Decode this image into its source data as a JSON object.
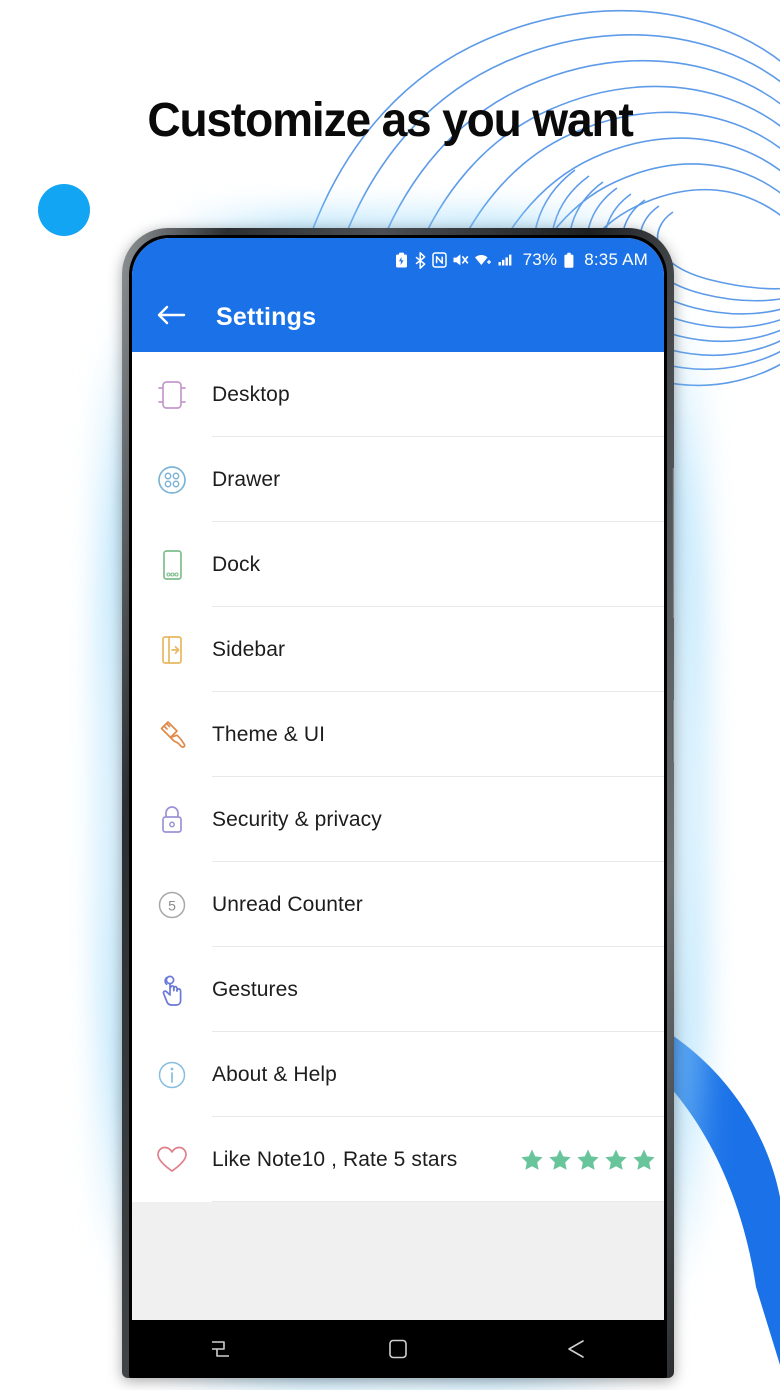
{
  "promo": {
    "headline": "Customize as you want",
    "accent_color": "#1B72E8",
    "dot_color": "#12A5F4",
    "decor_line_color": "#5596E8"
  },
  "phone": {
    "statusbar": {
      "icons": [
        "battery-saver-icon",
        "bluetooth-icon",
        "nfc-icon",
        "mute-icon",
        "wifi-icon",
        "cellular-signal-icon"
      ],
      "battery_percent": "73%",
      "battery_icon": "battery-icon",
      "time": "8:35 AM"
    },
    "appbar": {
      "back_icon": "arrow-left-icon",
      "title": "Settings"
    },
    "settings_list": [
      {
        "label": "Desktop",
        "icon": "desktop-icon",
        "color": "#C49ACB"
      },
      {
        "label": "Drawer",
        "icon": "drawer-grid-icon",
        "color": "#7EB5D6"
      },
      {
        "label": "Dock",
        "icon": "dock-icon",
        "color": "#7FBE8C"
      },
      {
        "label": "Sidebar",
        "icon": "sidebar-icon",
        "color": "#E8B860"
      },
      {
        "label": "Theme & UI",
        "icon": "paintbrush-icon",
        "color": "#E08948"
      },
      {
        "label": "Security & privacy",
        "icon": "lock-icon",
        "color": "#9A93D8"
      },
      {
        "label": "Unread Counter",
        "icon": "counter-badge-icon",
        "color": "#A8A8A8",
        "badge": "5"
      },
      {
        "label": "Gestures",
        "icon": "tap-hand-icon",
        "color": "#6B79D8"
      },
      {
        "label": "About & Help",
        "icon": "info-icon",
        "color": "#86BEE0"
      },
      {
        "label": "Like Note10 , Rate 5 stars",
        "icon": "heart-icon",
        "color": "#E0808C",
        "rating": {
          "stars": 5,
          "star_icon": "star-icon",
          "star_color": "#68C49B"
        }
      }
    ],
    "navbar": {
      "buttons": [
        {
          "name": "recents-icon"
        },
        {
          "name": "home-icon"
        },
        {
          "name": "back-icon"
        }
      ]
    },
    "side_buttons": [
      {
        "name": "volume-rocker"
      },
      {
        "name": "power-button"
      }
    ]
  }
}
